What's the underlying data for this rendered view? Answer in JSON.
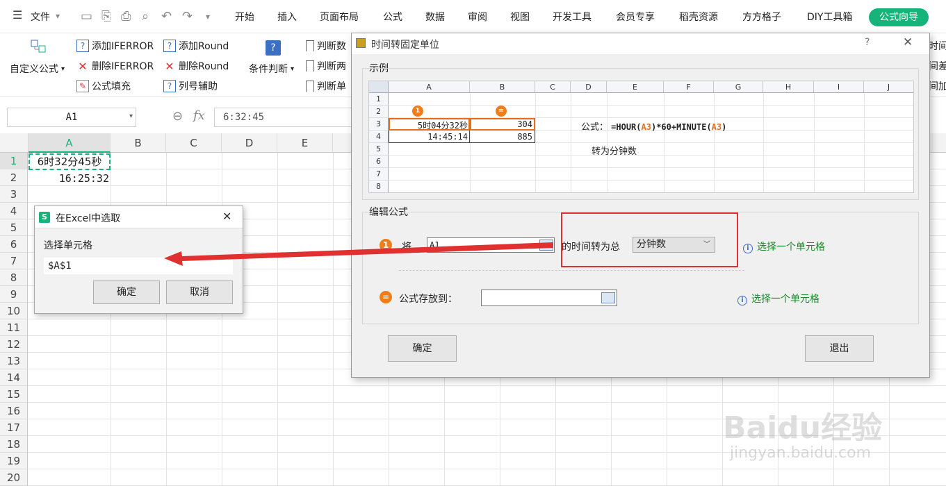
{
  "menu": {
    "items": [
      "文件",
      "开始",
      "插入",
      "页面布局",
      "公式",
      "数据",
      "审阅",
      "视图",
      "开发工具",
      "会员专享",
      "稻壳资源",
      "方方格子",
      "DIY工具箱",
      "公式向导"
    ],
    "active": "公式向导"
  },
  "ribbon": {
    "custom_formula": "自定义公式",
    "add_iferror": "添加IFERROR",
    "del_iferror": "删除IFERROR",
    "formula_fill": "公式填充",
    "add_round": "添加Round",
    "del_round": "删除Round",
    "col_assist": "列号辅助",
    "cond_judge": "条件判断",
    "judge1": "判断数",
    "judge2": "判断两",
    "judge3": "判断单",
    "right1": "时间",
    "right2": "间差",
    "right3": "间加"
  },
  "formula_bar": {
    "name_box": "A1",
    "fx": "fx",
    "content": "6:32:45"
  },
  "sheet": {
    "columns": [
      "A",
      "B",
      "C",
      "D",
      "E"
    ],
    "rows": [
      "1",
      "2",
      "3",
      "4",
      "5",
      "6",
      "7",
      "8",
      "9",
      "10",
      "11",
      "12",
      "13",
      "14",
      "15",
      "16",
      "17",
      "18",
      "19",
      "20"
    ],
    "a1": "6时32分45秒",
    "a2": "16:25:32"
  },
  "select_dialog": {
    "title": "在Excel中选取",
    "label": "选择单元格",
    "value": "$A$1",
    "ok": "确定",
    "cancel": "取消"
  },
  "main_dialog": {
    "title": "时间转固定单位",
    "help": "?",
    "example_label": "示例",
    "example": {
      "cols": [
        "A",
        "B",
        "C",
        "D",
        "E",
        "F",
        "G",
        "H",
        "I",
        "J"
      ],
      "rows": [
        "1",
        "2",
        "3",
        "4",
        "5",
        "6",
        "7",
        "8"
      ],
      "a3": "5时04分32秒",
      "b3": "304",
      "a4": "14:45:14",
      "b4": "885",
      "formula_label": "公式：",
      "formula_pre": "=HOUR(",
      "formula_ref1": "A3",
      "formula_mid": ")*60+MINUTE(",
      "formula_ref2": "A3",
      "formula_post": ")",
      "note": "转为分钟数",
      "marker1": "1",
      "marker2": "="
    },
    "edit_label": "编辑公式",
    "step1_marker": "1",
    "step1_prefix": "将",
    "step1_input": "A1",
    "step1_mid": "的时间转为总",
    "unit_select": "分钟数",
    "hint1": "选择一个单元格",
    "step2_marker": "=",
    "step2_label": "公式存放到：",
    "step2_input": "",
    "hint2": "选择一个单元格",
    "ok": "确定",
    "exit": "退出"
  },
  "watermark": {
    "brand": "Baidu经验",
    "url": "jingyan.baidu.com"
  },
  "colors": {
    "accent": "#16b37a",
    "orange": "#f07d1a",
    "red_box": "#e03030",
    "arrow": "#e03030"
  }
}
